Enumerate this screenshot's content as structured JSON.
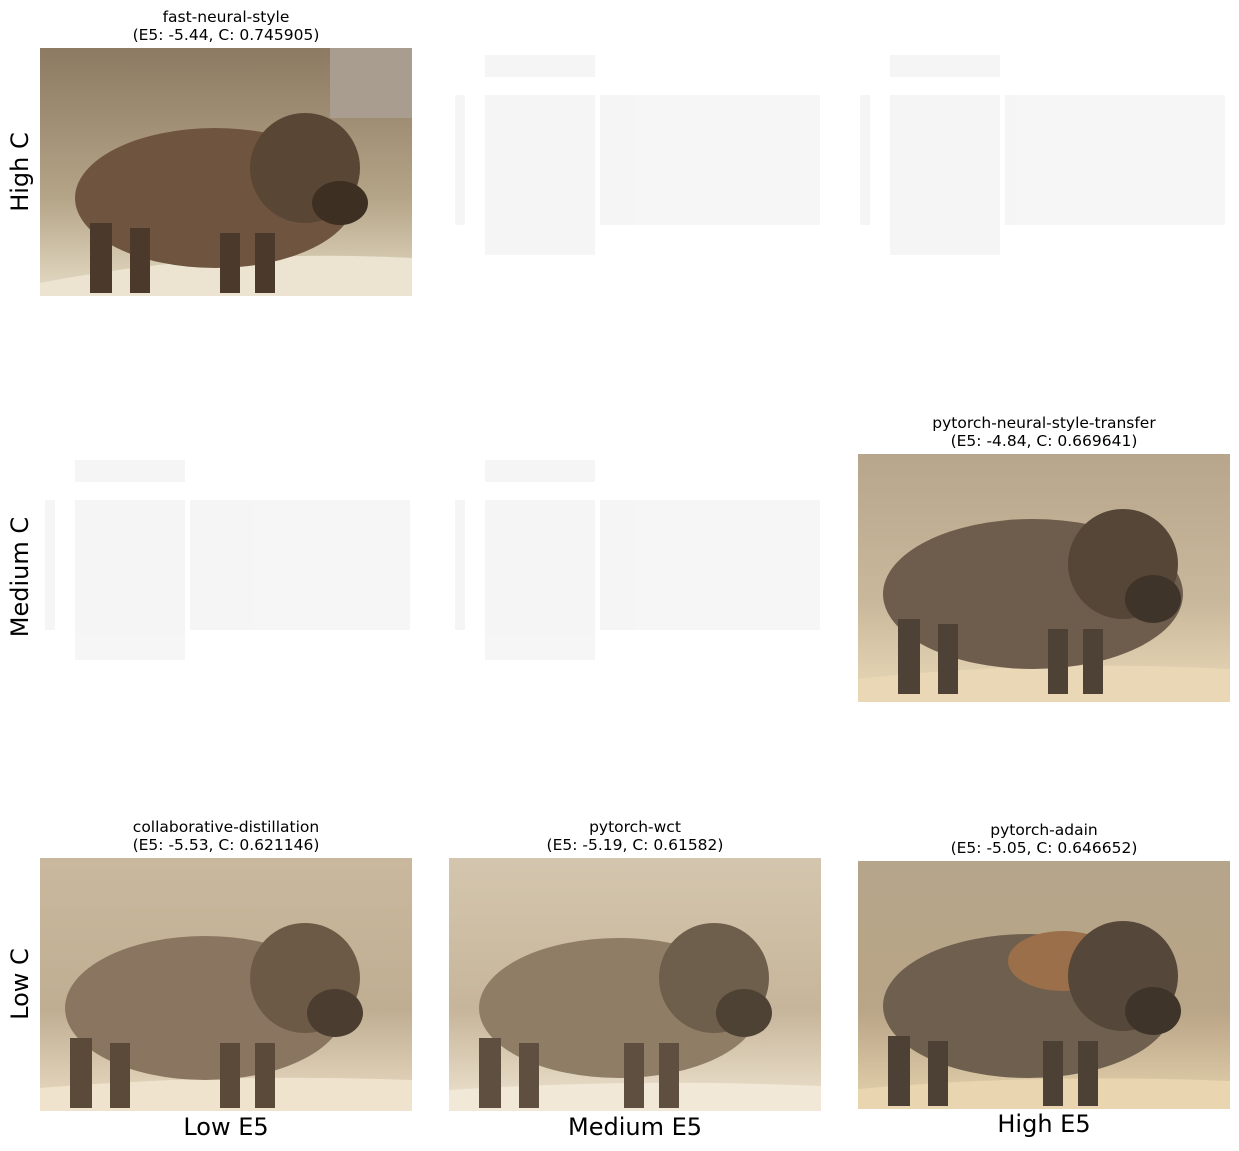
{
  "row_labels": [
    "High C",
    "Medium C",
    "Low C"
  ],
  "col_labels": [
    "Low E5",
    "Medium E5",
    "High E5"
  ],
  "panels": {
    "high_low": {
      "name": "fast-neural-style",
      "metrics": "(E5: -5.44, C: 0.745905)"
    },
    "med_high": {
      "name": "pytorch-neural-style-transfer",
      "metrics": "(E5: -4.84, C: 0.669641)"
    },
    "low_low": {
      "name": "collaborative-distillation",
      "metrics": "(E5: -5.53, C: 0.621146)"
    },
    "low_med": {
      "name": "pytorch-wct",
      "metrics": "(E5: -5.19, C: 0.61582)"
    },
    "low_high": {
      "name": "pytorch-adain",
      "metrics": "(E5: -5.05, C: 0.646652)"
    }
  }
}
